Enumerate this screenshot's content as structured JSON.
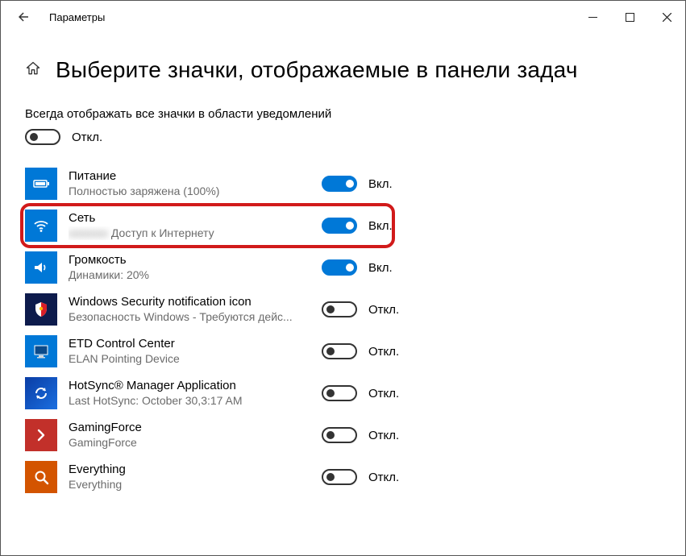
{
  "window": {
    "title": "Параметры"
  },
  "page": {
    "heading": "Выберите значки, отображаемые в панели задач"
  },
  "always": {
    "label": "Всегда отображать все значки в области уведомлений",
    "state_text": "Откл.",
    "on": false
  },
  "state_labels": {
    "on": "Вкл.",
    "off": "Откл."
  },
  "items": [
    {
      "title": "Питание",
      "subtitle": "Полностью заряжена (100%)",
      "on": true,
      "icon": "battery",
      "box": "",
      "highlight": false
    },
    {
      "title": "Сеть",
      "subtitle_prefix_blur": "xxxxxxx",
      "subtitle": " Доступ к Интернету",
      "on": true,
      "icon": "wifi",
      "box": "",
      "highlight": true
    },
    {
      "title": "Громкость",
      "subtitle": "Динамики: 20%",
      "on": true,
      "icon": "speaker",
      "box": "",
      "highlight": false
    },
    {
      "title": "Windows Security notification icon",
      "subtitle": "Безопасность Windows - Требуются дейс...",
      "on": false,
      "icon": "shield",
      "box": "sec",
      "highlight": false
    },
    {
      "title": "ETD Control Center",
      "subtitle": "ELAN Pointing Device",
      "on": false,
      "icon": "monitor",
      "box": "",
      "highlight": false
    },
    {
      "title": "HotSync® Manager Application",
      "subtitle": "Last HotSync: October 30,3:17 AM",
      "on": false,
      "icon": "sync",
      "box": "bluegrad",
      "highlight": false
    },
    {
      "title": "GamingForce",
      "subtitle": "GamingForce",
      "on": false,
      "icon": "chev",
      "box": "redish",
      "highlight": false
    },
    {
      "title": "Everything",
      "subtitle": "Everything",
      "on": false,
      "icon": "search",
      "box": "ornge",
      "highlight": false
    }
  ]
}
